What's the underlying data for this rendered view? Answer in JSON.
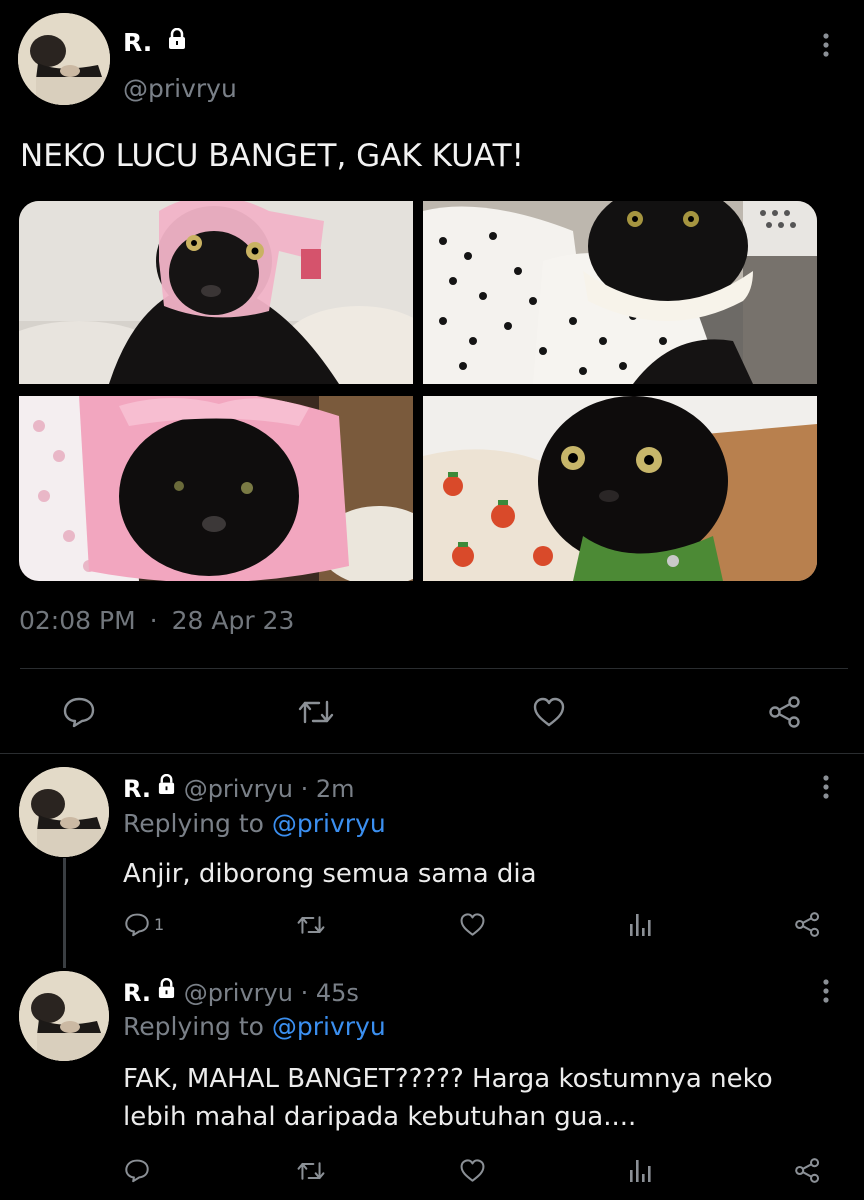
{
  "main_tweet": {
    "display_name": "R.",
    "handle": "@privryu",
    "text": "NEKO LUCU BANGET, GAK KUAT!",
    "time": "02:08 PM",
    "separator": "·",
    "date": "28 Apr 23"
  },
  "replies": [
    {
      "display_name": "R.",
      "handle": "@privryu",
      "age": "· 2m",
      "replying_prefix": "Replying to",
      "replying_to": "@privryu",
      "text": "Anjir, diborong semua sama dia",
      "reply_count": "1"
    },
    {
      "display_name": "R.",
      "handle": "@privryu",
      "age": "· 45s",
      "replying_prefix": "Replying to",
      "replying_to": "@privryu",
      "text_line1": "FAK, MAHAL BANGET????? Harga kostumnya neko",
      "text_line2": "lebih mahal daripada kebutuhan gua...."
    }
  ],
  "colors": {
    "background": "#000000",
    "muted": "#7a8088",
    "link": "#3b8ff0"
  },
  "icons": [
    "lock-icon",
    "more-vertical-icon",
    "reply-icon",
    "retweet-icon",
    "like-icon",
    "share-icon",
    "analytics-icon"
  ]
}
